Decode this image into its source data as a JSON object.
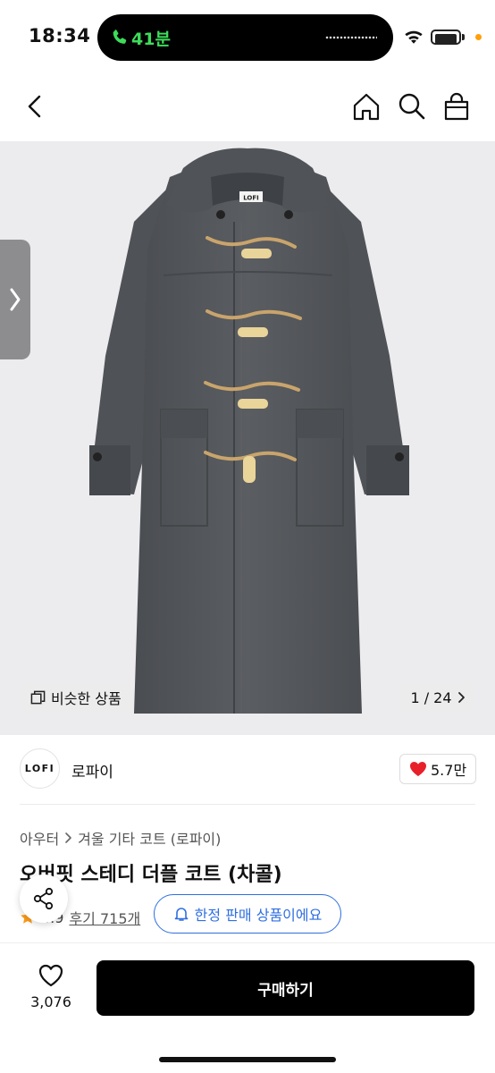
{
  "status_bar": {
    "time": "18:34",
    "call_duration": "41분"
  },
  "nav": {
    "back_icon": "chevron-left-icon",
    "home_icon": "home-icon",
    "search_icon": "search-icon",
    "bag_icon": "shopping-bag-icon"
  },
  "gallery": {
    "similar_label": "비슷한 상품",
    "page_counter": "1 / 24",
    "garment_tag": "LOFI"
  },
  "shop": {
    "logo_text": "LOFI",
    "name": "로파이",
    "likes": "5.7만"
  },
  "product": {
    "breadcrumb": [
      "아우터",
      "겨울 기타 코트 (로파이)"
    ],
    "title": "오버핏 스테디 더플 코트 (차콜)",
    "rating": "4.9",
    "reviews": "후기 715개",
    "limited_label": "한정 판매 상품이에요"
  },
  "bottom_bar": {
    "wish_count": "3,076",
    "buy_label": "구매하기"
  },
  "colors": {
    "call_green": "#3ddc5a",
    "accent_blue": "#2f6fe0",
    "like_red": "#e8202a",
    "coat_charcoal": "#55585c",
    "image_bg": "#ececee"
  }
}
